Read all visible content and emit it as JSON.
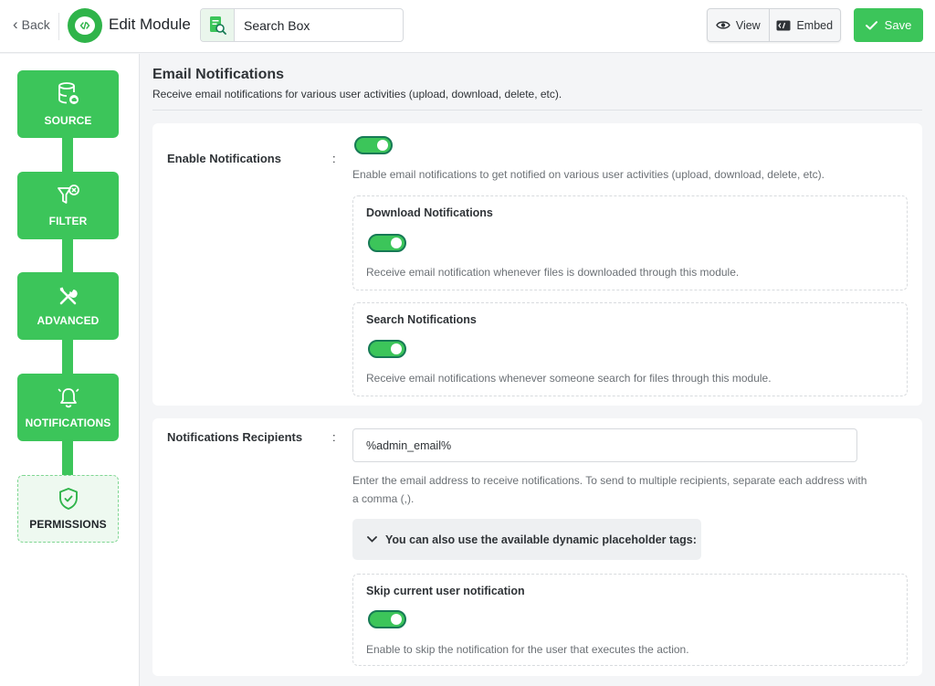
{
  "header": {
    "back_label": "Back",
    "title": "Edit Module",
    "module_name": "Search Box",
    "view_label": "View",
    "embed_label": "Embed",
    "save_label": "Save",
    "accent_color": "#3cc55a"
  },
  "sidebar": {
    "steps": [
      {
        "label": "SOURCE",
        "icon": "database-icon",
        "state": "done"
      },
      {
        "label": "FILTER",
        "icon": "filter-icon",
        "state": "done"
      },
      {
        "label": "ADVANCED",
        "icon": "tools-icon",
        "state": "done"
      },
      {
        "label": "NOTIFICATIONS",
        "icon": "bell-icon",
        "state": "active"
      },
      {
        "label": "PERMISSIONS",
        "icon": "shield-check-icon",
        "state": "pending"
      }
    ]
  },
  "section": {
    "title": "Email Notifications",
    "description": "Receive email notifications for various user activities (upload, download, delete, etc)."
  },
  "enable": {
    "label": "Enable Notifications",
    "colon": ":",
    "enabled": true,
    "help": "Enable email notifications to get notified on various user activities (upload, download, delete, etc).",
    "download": {
      "title": "Download Notifications",
      "enabled": true,
      "help": "Receive email notification whenever files is downloaded through this module."
    },
    "search": {
      "title": "Search Notifications",
      "enabled": true,
      "help": "Receive email notifications whenever someone search for files through this module."
    }
  },
  "recipients": {
    "label": "Notifications Recipients",
    "colon": ":",
    "value": "%admin_email%",
    "help_line1": "Enter the email address to receive notifications. To send to multiple recipients, separate each address with",
    "help_line2": "a comma (,).",
    "placeholder_toggle": "You can also use the available dynamic placeholder tags:",
    "skip": {
      "title": "Skip current user notification",
      "enabled": true,
      "help": "Enable to skip the notification for the user that executes the action."
    }
  }
}
